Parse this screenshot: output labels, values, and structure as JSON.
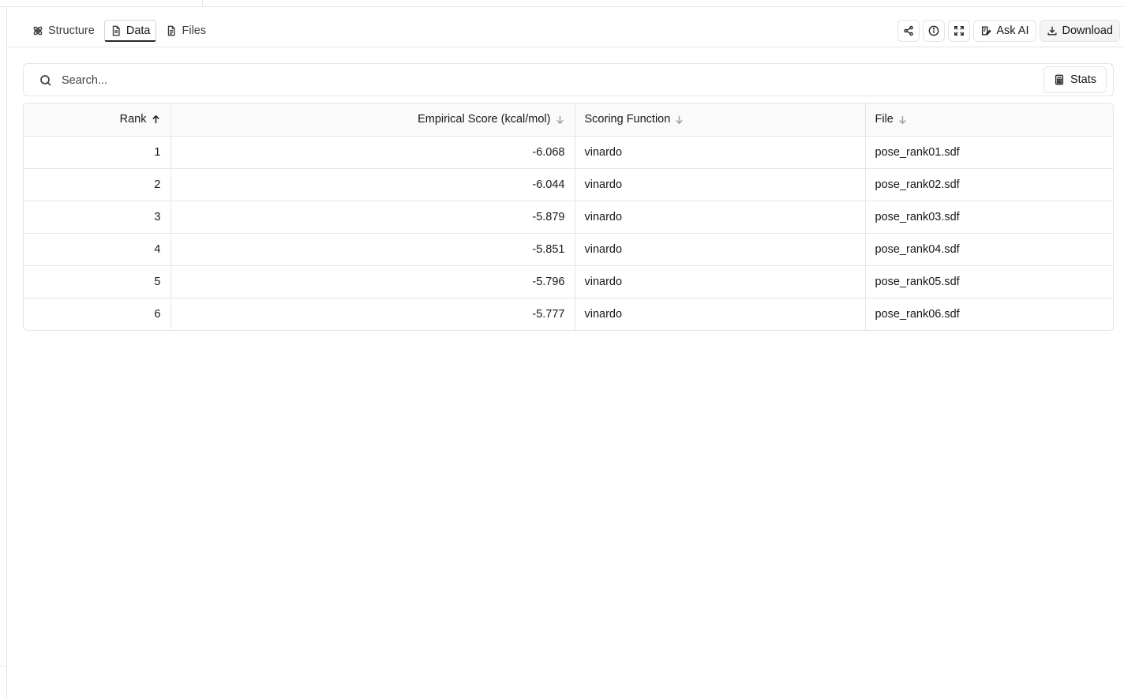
{
  "tabs": [
    {
      "label": "Structure",
      "icon": "atom-icon",
      "active": false
    },
    {
      "label": "Data",
      "icon": "document-icon",
      "active": true
    },
    {
      "label": "Files",
      "icon": "file-icon",
      "active": false
    }
  ],
  "actions": {
    "share_icon": "share-icon",
    "info_icon": "info-icon",
    "fullscreen_icon": "expand-icon",
    "ask_ai_label": "Ask AI",
    "download_label": "Download"
  },
  "search": {
    "placeholder": "Search...",
    "value": "",
    "stats_label": "Stats"
  },
  "table": {
    "columns": [
      {
        "label": "Rank",
        "sort": "asc",
        "align": "num"
      },
      {
        "label": "Empirical Score (kcal/mol)",
        "sort": "desc",
        "align": "num"
      },
      {
        "label": "Scoring Function",
        "sort": "desc",
        "align": "txt"
      },
      {
        "label": "File",
        "sort": "desc",
        "align": "txt"
      }
    ],
    "rows": [
      [
        "1",
        "-6.068",
        "vinardo",
        "pose_rank01.sdf"
      ],
      [
        "2",
        "-6.044",
        "vinardo",
        "pose_rank02.sdf"
      ],
      [
        "3",
        "-5.879",
        "vinardo",
        "pose_rank03.sdf"
      ],
      [
        "4",
        "-5.851",
        "vinardo",
        "pose_rank04.sdf"
      ],
      [
        "5",
        "-5.796",
        "vinardo",
        "pose_rank05.sdf"
      ],
      [
        "6",
        "-5.777",
        "vinardo",
        "pose_rank06.sdf"
      ]
    ]
  }
}
